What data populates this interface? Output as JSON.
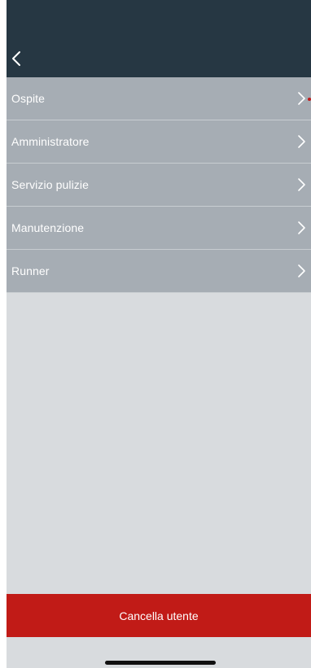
{
  "header": {
    "back_icon": "chevron-left-icon"
  },
  "roles": {
    "items": [
      {
        "label": "Ospite",
        "has_indicator": true
      },
      {
        "label": "Amministratore",
        "has_indicator": false
      },
      {
        "label": "Servizio pulizie",
        "has_indicator": false
      },
      {
        "label": "Manutenzione",
        "has_indicator": false
      },
      {
        "label": "Runner",
        "has_indicator": false
      }
    ]
  },
  "footer": {
    "delete_label": "Cancella utente"
  },
  "colors": {
    "header_bg": "#263743",
    "row_bg": "#a6adb4",
    "page_bg": "#d8dbde",
    "danger": "#c11b17"
  }
}
